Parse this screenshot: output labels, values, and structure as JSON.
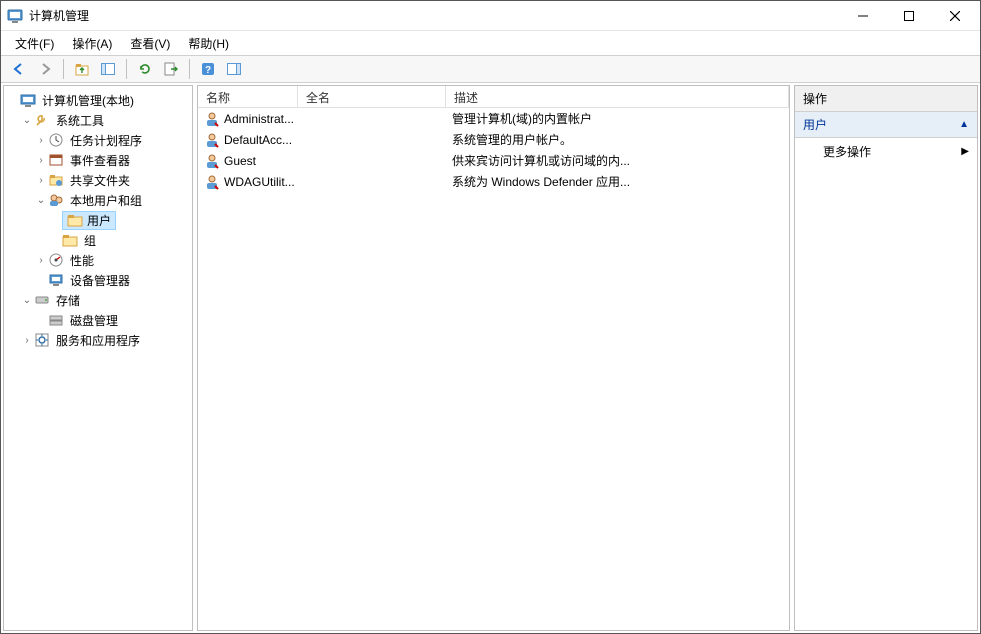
{
  "window": {
    "title": "计算机管理"
  },
  "menu": {
    "file": "文件(F)",
    "action": "操作(A)",
    "view": "查看(V)",
    "help": "帮助(H)"
  },
  "tree": {
    "root": "计算机管理(本地)",
    "system_tools": "系统工具",
    "task_scheduler": "任务计划程序",
    "event_viewer": "事件查看器",
    "shared_folders": "共享文件夹",
    "local_users_groups": "本地用户和组",
    "users": "用户",
    "groups": "组",
    "performance": "性能",
    "device_manager": "设备管理器",
    "storage": "存储",
    "disk_management": "磁盘管理",
    "services_apps": "服务和应用程序"
  },
  "list": {
    "columns": {
      "name": "名称",
      "full_name": "全名",
      "description": "描述"
    },
    "rows": [
      {
        "name": "Administrat...",
        "full_name": "",
        "description": "管理计算机(域)的内置帐户"
      },
      {
        "name": "DefaultAcc...",
        "full_name": "",
        "description": "系统管理的用户帐户。"
      },
      {
        "name": "Guest",
        "full_name": "",
        "description": "供来宾访问计算机或访问域的内..."
      },
      {
        "name": "WDAGUtilit...",
        "full_name": "",
        "description": "系统为 Windows Defender 应用..."
      }
    ]
  },
  "actions": {
    "header": "操作",
    "section": "用户",
    "more": "更多操作"
  }
}
